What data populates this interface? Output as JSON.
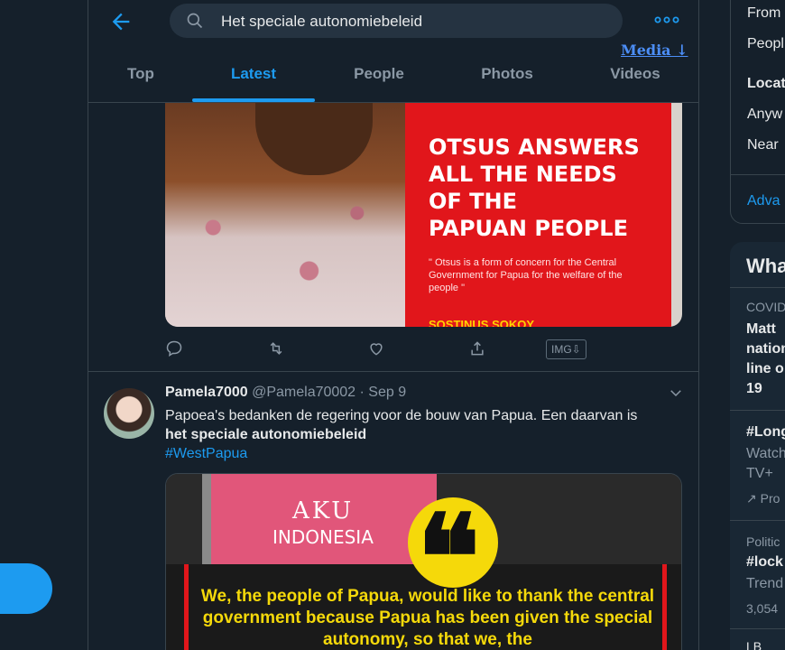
{
  "header": {
    "search_value": "Het speciale autonomiebeleid",
    "media_link": "Media ↓",
    "tabs": [
      {
        "label": "Top",
        "active": false
      },
      {
        "label": "Latest",
        "active": true
      },
      {
        "label": "People",
        "active": false
      },
      {
        "label": "Photos",
        "active": false
      },
      {
        "label": "Videos",
        "active": false
      }
    ]
  },
  "tweet1": {
    "image": {
      "headline_lines": [
        "OTSUS ANSWERS",
        "ALL THE NEEDS",
        "OF THE",
        "PAPUAN PEOPLE"
      ],
      "subtext": "\" Otsus is a form of concern for the Central Government for Papua for the welfare of the people \"",
      "bottom_text": "SOSTINUS SOKOY"
    },
    "actions": {
      "reply_icon": "reply-icon",
      "retweet_icon": "retweet-icon",
      "like_icon": "like-icon",
      "share_icon": "share-icon",
      "img_download": "IMG⇩"
    }
  },
  "tweet2": {
    "name": "Pamela7000",
    "handle": "@Pamela70002",
    "separator": " · ",
    "date": "Sep 9",
    "text_line": "Papoea's bedanken de regering voor de bouw van Papua.  Een daarvan is",
    "text_bold": "het speciale autonomiebeleid",
    "hashtag": "#WestPapua",
    "image": {
      "aku": "AKU",
      "indonesia": "INDONESIA",
      "quote_mark": "❝",
      "quote_text": "We, the people of Papua, would like to thank the central government because Papua has been given the special autonomy, so that we, the"
    }
  },
  "right_panel": {
    "filters": {
      "from": "From",
      "people": "Peopl",
      "location_heading": "Locat",
      "anywhere": "Anyw",
      "near": "Near",
      "advanced": "Adva"
    },
    "trends": {
      "heading": "Wha",
      "items": [
        {
          "context": "COVID",
          "lines": [
            "Matt",
            "nation",
            "line o",
            "19"
          ]
        },
        {
          "context": "",
          "lines": [
            "#Long",
            "Watch",
            "TV+"
          ],
          "promoted": "Pro"
        },
        {
          "context": "Politic",
          "lines": [
            "#lock",
            "Trend"
          ],
          "count": "3,054"
        }
      ],
      "last_item_prefix": "LB"
    }
  }
}
